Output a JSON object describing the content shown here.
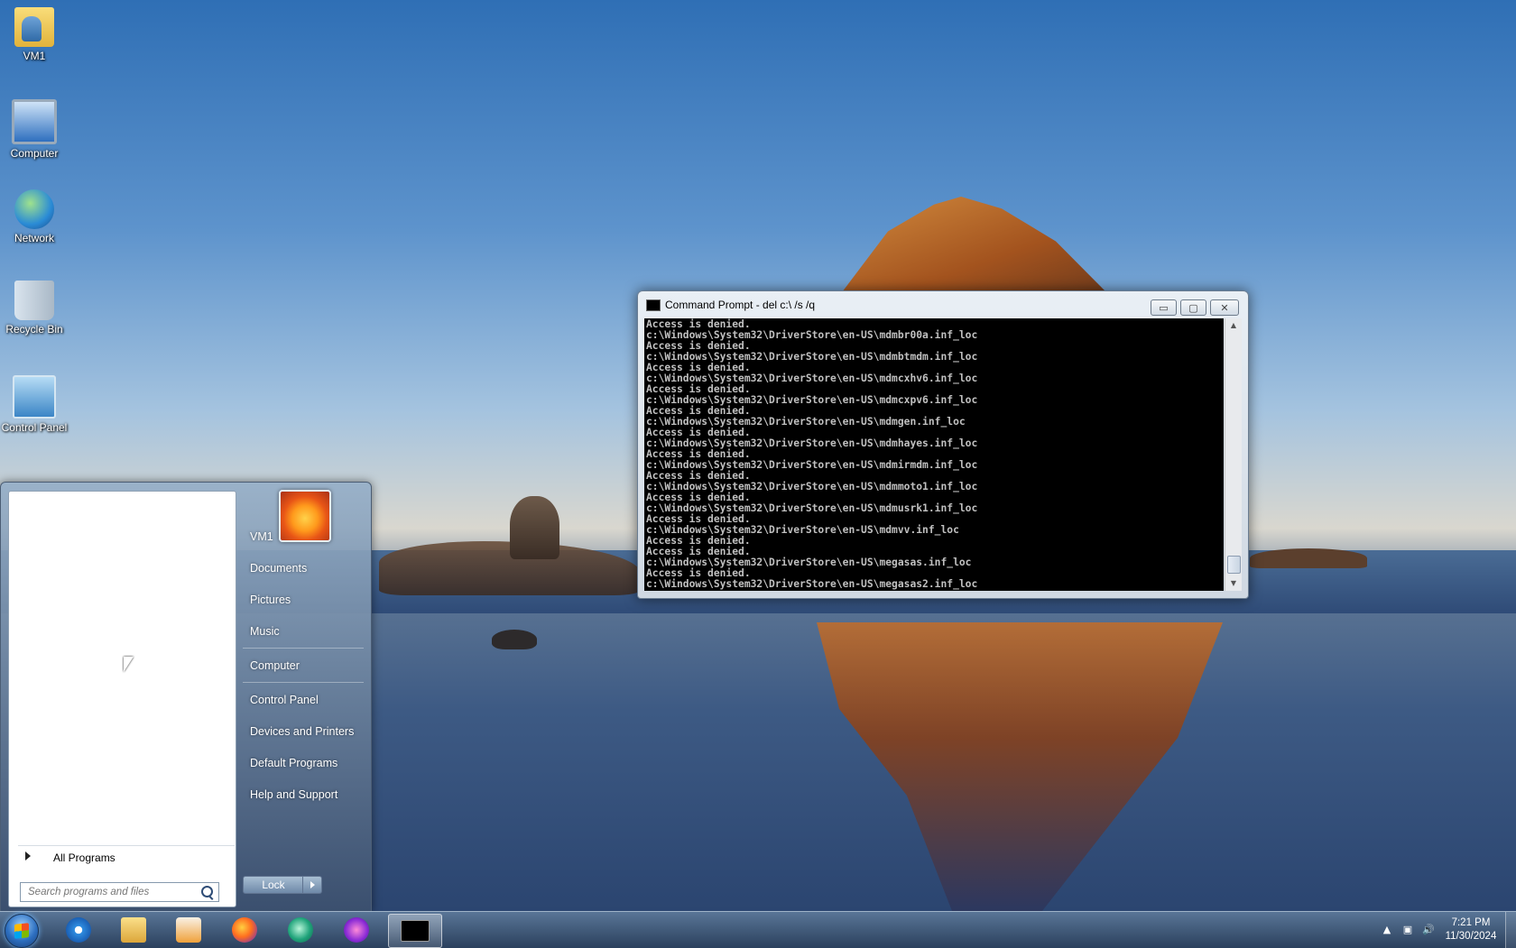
{
  "desktop": {
    "icons": [
      {
        "label": "VM1",
        "icon": "user-folder-icon"
      },
      {
        "label": "Computer",
        "icon": "computer-icon"
      },
      {
        "label": "Network",
        "icon": "network-icon"
      },
      {
        "label": "Recycle Bin",
        "icon": "recycle-bin-icon"
      },
      {
        "label": "Control Panel",
        "icon": "control-panel-icon"
      }
    ]
  },
  "cmd_window": {
    "title": "Command Prompt - del  c:\\ /s /q",
    "minimize_symbol": "▭",
    "maximize_symbol": "▢",
    "close_symbol": "✕",
    "lines": [
      "Access is denied.",
      "c:\\Windows\\System32\\DriverStore\\en-US\\mdmbr00a.inf_loc",
      "Access is denied.",
      "c:\\Windows\\System32\\DriverStore\\en-US\\mdmbtmdm.inf_loc",
      "Access is denied.",
      "c:\\Windows\\System32\\DriverStore\\en-US\\mdmcxhv6.inf_loc",
      "Access is denied.",
      "c:\\Windows\\System32\\DriverStore\\en-US\\mdmcxpv6.inf_loc",
      "Access is denied.",
      "c:\\Windows\\System32\\DriverStore\\en-US\\mdmgen.inf_loc",
      "Access is denied.",
      "c:\\Windows\\System32\\DriverStore\\en-US\\mdmhayes.inf_loc",
      "Access is denied.",
      "c:\\Windows\\System32\\DriverStore\\en-US\\mdmirmdm.inf_loc",
      "Access is denied.",
      "c:\\Windows\\System32\\DriverStore\\en-US\\mdmmoto1.inf_loc",
      "Access is denied.",
      "c:\\Windows\\System32\\DriverStore\\en-US\\mdmusrk1.inf_loc",
      "Access is denied.",
      "c:\\Windows\\System32\\DriverStore\\en-US\\mdmvv.inf_loc",
      "Access is denied.",
      "Access is denied.",
      "c:\\Windows\\System32\\DriverStore\\en-US\\megasas.inf_loc",
      "Access is denied.",
      "c:\\Windows\\System32\\DriverStore\\en-US\\megasas2.inf_loc"
    ]
  },
  "start_menu": {
    "all_programs_label": "All Programs",
    "search_placeholder": "Search programs and files",
    "right_items": [
      "VM1",
      "Documents",
      "Pictures",
      "Music",
      "Computer",
      "Control Panel",
      "Devices and Printers",
      "Default Programs",
      "Help and Support"
    ],
    "lock_label": "Lock"
  },
  "taskbar": {
    "pinned": [
      {
        "id": "ie",
        "icon": "internet-explorer-icon"
      },
      {
        "id": "explorer",
        "icon": "file-explorer-icon"
      },
      {
        "id": "media",
        "icon": "media-player-icon"
      },
      {
        "id": "firefox",
        "icon": "firefox-icon"
      },
      {
        "id": "app5",
        "icon": "chat-app-icon"
      },
      {
        "id": "app6",
        "icon": "purple-app-icon"
      },
      {
        "id": "cmd",
        "icon": "command-prompt-icon",
        "active": true
      }
    ],
    "tray": {
      "show_hidden_symbol": "▲",
      "network_symbol": "▣",
      "volume_symbol": "🔊"
    },
    "clock": {
      "time": "7:21 PM",
      "date": "11/30/2024"
    }
  }
}
